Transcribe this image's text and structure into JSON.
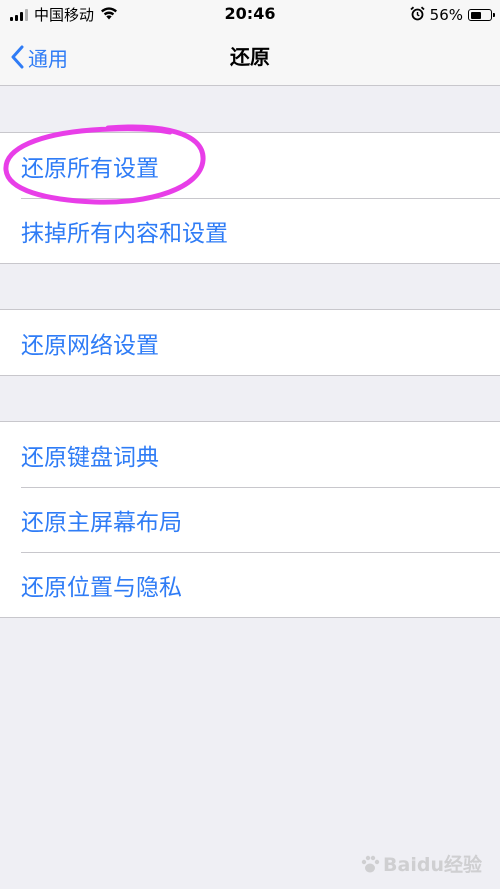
{
  "status_bar": {
    "carrier": "中国移动",
    "time": "20:46",
    "battery_percent_label": "56%",
    "battery_level": 0.56,
    "icons": [
      "signal-icon",
      "wifi-icon",
      "alarm-icon",
      "battery-icon"
    ]
  },
  "nav": {
    "back_label": "通用",
    "title": "还原"
  },
  "groups": [
    {
      "items": [
        {
          "label": "还原所有设置",
          "highlighted": true
        },
        {
          "label": "抹掉所有内容和设置"
        }
      ]
    },
    {
      "items": [
        {
          "label": "还原网络设置"
        }
      ]
    },
    {
      "items": [
        {
          "label": "还原键盘词典"
        },
        {
          "label": "还原主屏幕布局"
        },
        {
          "label": "还原位置与隐私"
        }
      ]
    }
  ],
  "watermark": {
    "text": "Baidu经验"
  },
  "colors": {
    "accent": "#2f7cf6",
    "background": "#efeff4",
    "highlight": "#e83ee8"
  }
}
